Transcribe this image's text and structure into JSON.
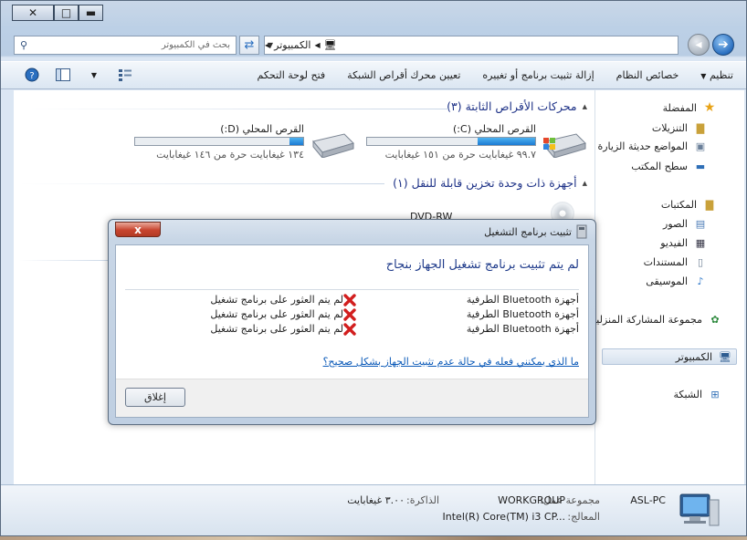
{
  "window": {
    "caption_buttons": {
      "minimize": "▬",
      "maximize": "□",
      "close": "✕"
    }
  },
  "address": {
    "path": [
      "الكمبيوتر"
    ],
    "search_placeholder": "بحث في الكمبيوتر"
  },
  "toolbar": {
    "organize": "تنظيم",
    "system_properties": "خصائص النظام",
    "uninstall": "إزالة تثبيت برنامج أو تغييره",
    "map_drive": "تعيين محرك أقراص الشبكة",
    "control_panel": "فتح لوحة التحكم"
  },
  "navpane": {
    "favorites": "المفضلة",
    "downloads": "التنزيلات",
    "recent": "المواضع حديثة الزيارة",
    "desktop": "سطح المكتب",
    "libraries": "المكتبات",
    "pictures": "الصور",
    "videos": "الفيديو",
    "documents": "المستندات",
    "music": "الموسيقى",
    "homegroup": "مجموعة المشاركة المنزلية",
    "computer": "الكمبيوتر",
    "network": "الشبكة"
  },
  "content": {
    "hdd_group": "محركات الأقراص الثابتة (٣)",
    "removable_group": "أجهزة ذات وحدة تخزين قابلة للنقل (١)",
    "drives": [
      {
        "name": "القرص المحلي (C:)",
        "free": "٩٩.٧ غيغابايت حرة من ١٥١ غيغابايت",
        "used_fraction": 0.34
      },
      {
        "name": "القرص المحلي (D:)",
        "free": "١٣٤ غيغابايت حرة من ١٤٦ غيغابايت",
        "used_fraction": 0.08
      }
    ],
    "dvd_label": "DVD-RW"
  },
  "details": {
    "pc_name": "ASL-PC",
    "workgroup_label": "مجموعة عمل:",
    "workgroup_value": "WORKGROUP",
    "memory_label": "الذاكرة:",
    "memory_value": "٣.٠٠ غيغابايت",
    "processor_label": "المعالج:",
    "processor_value": "Intel(R) Core(TM) i3 CP..."
  },
  "dialog": {
    "title": "تثبيت برنامج التشغيل",
    "heading": "لم يتم تثبيت برنامج تشغيل الجهاز بنجاح",
    "devices": [
      {
        "name": "أجهزة Bluetooth الطرفية",
        "status": "لم يتم العثور على برنامج تشغيل"
      },
      {
        "name": "أجهزة Bluetooth الطرفية",
        "status": "لم يتم العثور على برنامج تشغيل"
      },
      {
        "name": "أجهزة Bluetooth الطرفية",
        "status": "لم يتم العثور على برنامج تشغيل"
      }
    ],
    "help_link": "ما الذي يمكنني فعله في حالة عدم تثبيت الجهاز بشكل صحيح؟",
    "close_button": "إغلاق",
    "close_x": "x"
  },
  "colors": {
    "accent": "#1e3287",
    "link": "#0a59b8",
    "error": "#d21e1e"
  }
}
